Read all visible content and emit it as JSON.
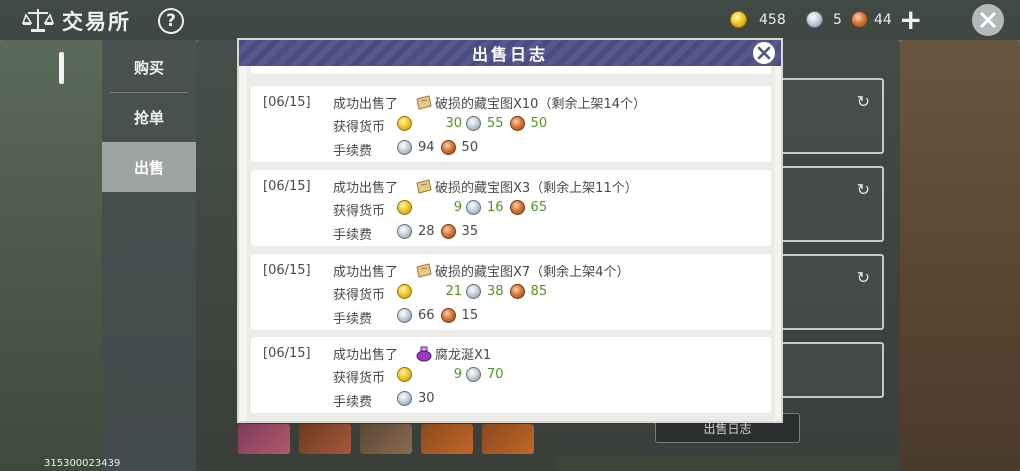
{
  "topbar": {
    "title": "交易所",
    "help": "?",
    "gold": "458",
    "silver": "5",
    "copper": "44"
  },
  "sidebar": {
    "tabs": [
      "购买",
      "抢单",
      "出售"
    ]
  },
  "device_id": "315300023439",
  "background": {
    "log_button": "出售日志"
  },
  "modal": {
    "title": "出售日志",
    "fee_label": "手续费",
    "earn_label": "获得货币",
    "entries": [
      {
        "date": "[06/15]",
        "action": "成功出售了",
        "item": "破损的藏宝图X10（剩余上架14个）",
        "earn_gold": "30",
        "earn_silver": "55",
        "earn_copper": "50",
        "fee_silver": "94",
        "fee_copper": "50"
      },
      {
        "date": "[06/15]",
        "action": "成功出售了",
        "item": "破损的藏宝图X3（剩余上架11个）",
        "earn_gold": "9",
        "earn_silver": "16",
        "earn_copper": "65",
        "fee_silver": "28",
        "fee_copper": "35"
      },
      {
        "date": "[06/15]",
        "action": "成功出售了",
        "item": "破损的藏宝图X7（剩余上架4个）",
        "earn_gold": "21",
        "earn_silver": "38",
        "earn_copper": "85",
        "fee_silver": "66",
        "fee_copper": "15"
      },
      {
        "date": "[06/15]",
        "action": "成功出售了",
        "item": "腐龙涎X1",
        "earn_gold": "9",
        "earn_silver": "70",
        "fee_silver": "30"
      }
    ]
  },
  "colors": {
    "header": "#4a4e7e",
    "earn_number": "#4c9a1c",
    "selected_tab": "#9ea3a3"
  }
}
